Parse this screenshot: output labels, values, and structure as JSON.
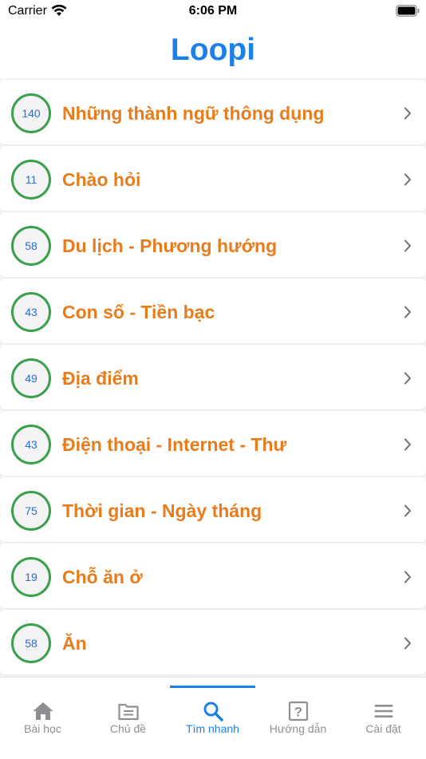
{
  "status_bar": {
    "carrier": "Carrier",
    "time": "6:06 PM"
  },
  "header": {
    "title": "Loopi"
  },
  "colors": {
    "accent": "#1d80e8",
    "label_orange": "#e87c1c",
    "badge_ring_green": "#3aa04a",
    "badge_text_blue": "#2a6fc9",
    "tab_inactive": "#8e8e93"
  },
  "topics": [
    {
      "count": "140",
      "label": "Những thành ngữ thông dụng"
    },
    {
      "count": "11",
      "label": "Chào hỏi"
    },
    {
      "count": "58",
      "label": "Du lịch - Phương hướng"
    },
    {
      "count": "43",
      "label": "Con số - Tiền bạc"
    },
    {
      "count": "49",
      "label": "Địa điểm"
    },
    {
      "count": "43",
      "label": "Điện thoại - Internet - Thư"
    },
    {
      "count": "75",
      "label": "Thời gian - Ngày tháng"
    },
    {
      "count": "19",
      "label": "Chỗ ăn ở"
    },
    {
      "count": "58",
      "label": "Ăn"
    }
  ],
  "tab_bar": {
    "tabs": [
      {
        "label": "Bài học",
        "icon": "home-icon"
      },
      {
        "label": "Chủ đề",
        "icon": "folder-icon"
      },
      {
        "label": "Tìm nhanh",
        "icon": "search-icon",
        "active": true
      },
      {
        "label": "Hướng dẫn",
        "icon": "help-icon"
      },
      {
        "label": "Cài đặt",
        "icon": "menu-icon"
      }
    ]
  }
}
